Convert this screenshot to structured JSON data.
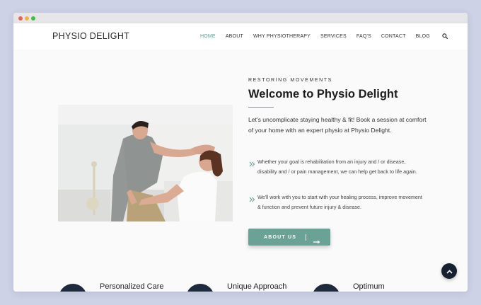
{
  "window": {
    "controls": [
      "close",
      "minimize",
      "maximize"
    ]
  },
  "header": {
    "logo": "PHYSIO DELIGHT",
    "nav": [
      {
        "label": "HOME",
        "active": true
      },
      {
        "label": "ABOUT"
      },
      {
        "label": "WHY PHYSIOTHERAPY"
      },
      {
        "label": "SERVICES"
      },
      {
        "label": "FAQ'S"
      },
      {
        "label": "CONTACT"
      },
      {
        "label": "BLOG"
      }
    ],
    "search_icon": "search-icon"
  },
  "hero": {
    "eyebrow": "RESTORING MOVEMENTS",
    "title": "Welcome to Physio Delight",
    "intro": "Let's uncomplicate staying healthy & fit! Book a session at comfort of your home with an expert physio at Physio Delight.",
    "bullets": [
      "Whether your goal is rehabilitation from an injury and / or disease, disability and / or pain management, we can help get back to life again.",
      "We'll work with you to start with your healing process, improve movement & function and prevent future injury & disease."
    ],
    "bullet_icon": "double-chevron-right-icon",
    "cta": {
      "label": "ABOUT US",
      "icon": "arrow-right-icon"
    },
    "image": "physiotherapist-treating-patient-neck-photo"
  },
  "features": [
    {
      "title": "Personalized Care"
    },
    {
      "title": "Unique Approach"
    },
    {
      "title": "Optimum"
    }
  ],
  "scroll_top": {
    "icon": "chevron-up-icon"
  },
  "colors": {
    "accent": "#6aa296",
    "dark": "#1f2a3d",
    "background": "#cdd2e6"
  }
}
